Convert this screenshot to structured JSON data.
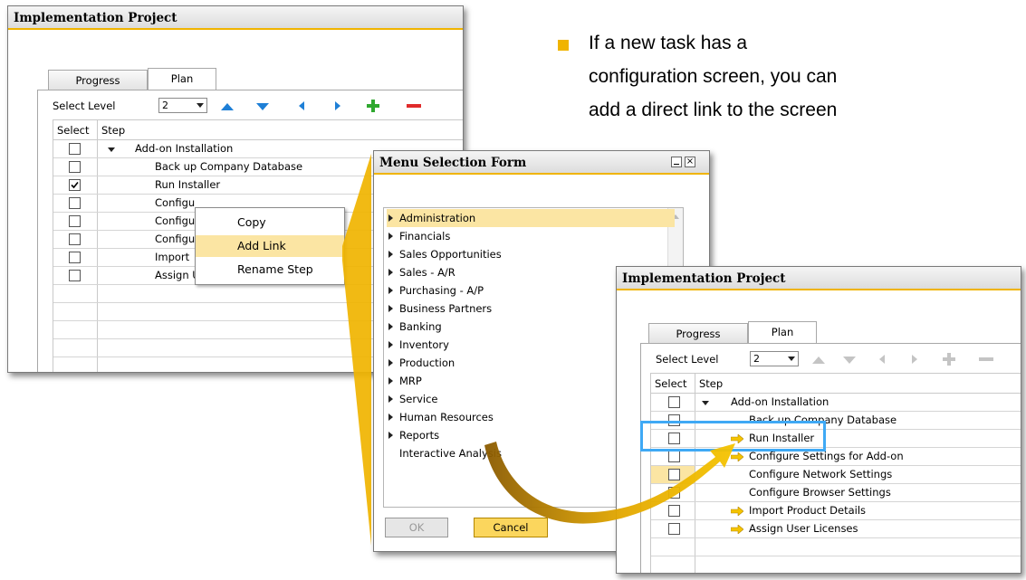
{
  "callout": {
    "lines": [
      "If a new task has a",
      "configuration screen, you can",
      "add a direct link to the screen"
    ]
  },
  "window1": {
    "title": "Implementation Project",
    "tabs": [
      "Progress",
      "Plan"
    ],
    "select_level_label": "Select Level",
    "level_value": "2",
    "headers": {
      "select": "Select",
      "step": "Step"
    },
    "rows": [
      {
        "text": "Add-on Installation",
        "checked": false
      },
      {
        "text": "Back up Company Database",
        "checked": false
      },
      {
        "text": "Run Installer",
        "checked": true
      },
      {
        "text": "Configu",
        "checked": false
      },
      {
        "text": "Configu",
        "checked": false
      },
      {
        "text": "Configu",
        "checked": false
      },
      {
        "text": "Import",
        "checked": false
      },
      {
        "text": "Assign User Licenses",
        "checked": false
      }
    ]
  },
  "context_menu": {
    "items": [
      "Copy",
      "Add Link",
      "Rename Step"
    ]
  },
  "menu_form": {
    "title": "Menu Selection Form",
    "items": [
      "Administration",
      "Financials",
      "Sales Opportunities",
      "Sales - A/R",
      "Purchasing - A/P",
      "Business Partners",
      "Banking",
      "Inventory",
      "Production",
      "MRP",
      "Service",
      "Human Resources",
      "Reports",
      "Interactive Analysis"
    ],
    "ok_label": "OK",
    "cancel_label": "Cancel"
  },
  "window2": {
    "title": "Implementation Project",
    "tabs": [
      "Progress",
      "Plan"
    ],
    "select_level_label": "Select Level",
    "level_value": "2",
    "headers": {
      "select": "Select",
      "step": "Step"
    },
    "rows": [
      "Add-on Installation",
      "Back up Company Database",
      "Run Installer",
      "Configure Settings for Add-on",
      "Configure Network Settings",
      "Configure Browser Settings",
      "Import Product Details",
      "Assign User Licenses"
    ]
  },
  "colors": {
    "accent": "#f0b400",
    "highlight": "#fbe5a3",
    "focus_box": "#3fa9f5",
    "nav_blue": "#1e7fd6",
    "add_green": "#2fa82f",
    "remove_red": "#e02b2b"
  }
}
